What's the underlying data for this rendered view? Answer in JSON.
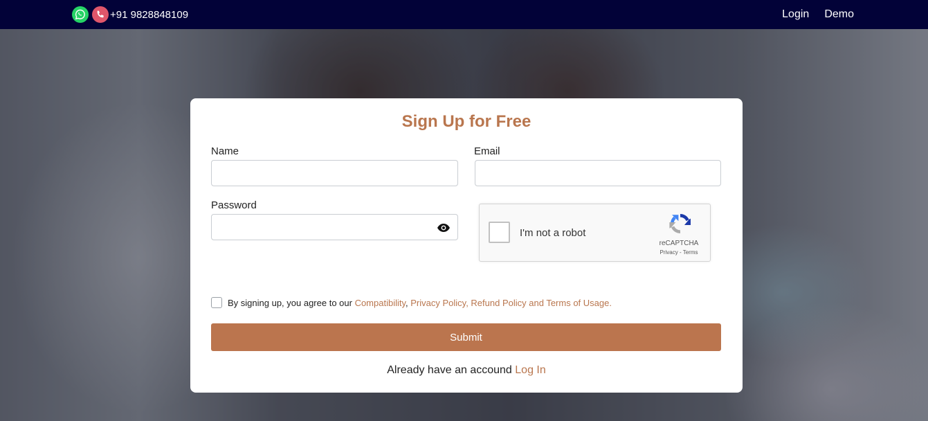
{
  "header": {
    "phone": "+91 9828848109",
    "nav": {
      "login": "Login",
      "demo": "Demo"
    }
  },
  "icons": {
    "whatsapp": "whatsapp-icon",
    "phone": "phone-icon",
    "password_toggle": "eye-icon",
    "recaptcha": "recaptcha-logo-icon"
  },
  "form": {
    "title": "Sign Up for Free",
    "name": {
      "label": "Name",
      "value": "",
      "placeholder": ""
    },
    "email": {
      "label": "Email",
      "value": "",
      "placeholder": ""
    },
    "password": {
      "label": "Password",
      "value": "",
      "placeholder": ""
    },
    "captcha": {
      "text": "I'm not a robot",
      "brand": "reCAPTCHA",
      "privacy": "Privacy",
      "separator": " - ",
      "terms": "Terms"
    },
    "agreement": {
      "prefix": "By signing up, you agree to our ",
      "compatibility": "Compatibility",
      "comma": ", ",
      "privacy": "Privacy Policy, ",
      "refund": "Refund Policy",
      "and": " and ",
      "terms": "Terms of Usage",
      "suffix": ".",
      "checked": false
    },
    "submit_label": "Submit",
    "login_prompt": "Already have an accound",
    "login_link": "Log In"
  },
  "colors": {
    "topbar": "#020238",
    "accent": "#bb754e",
    "whatsapp": "#25d366",
    "phone": "#e0566b"
  }
}
